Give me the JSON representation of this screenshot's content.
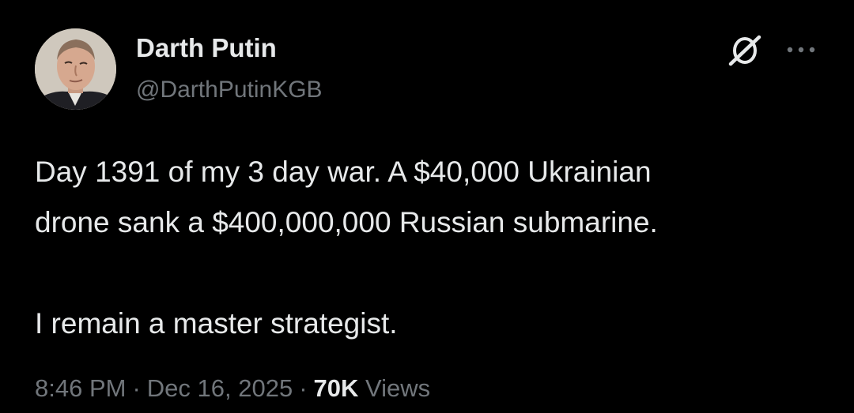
{
  "author": {
    "display_name": "Darth Putin",
    "handle": "@DarthPutinKGB",
    "avatar_icon": "profile-photo"
  },
  "header_actions": {
    "grok_icon": "grok-icon",
    "more_icon": "more-options-icon"
  },
  "tweet": {
    "lines": [
      "Day 1391 of my 3 day war. A $40,000 Ukrainian",
      "drone sank a $400,000,000 Russian submarine.",
      "I remain a master strategist."
    ]
  },
  "meta": {
    "time": "8:46 PM",
    "date": "Dec 16, 2025",
    "separator": "·",
    "views_count": "70K",
    "views_label": "Views"
  },
  "colors": {
    "background": "#000000",
    "primary_text": "#e7e9ea",
    "secondary_text": "#71767b"
  }
}
